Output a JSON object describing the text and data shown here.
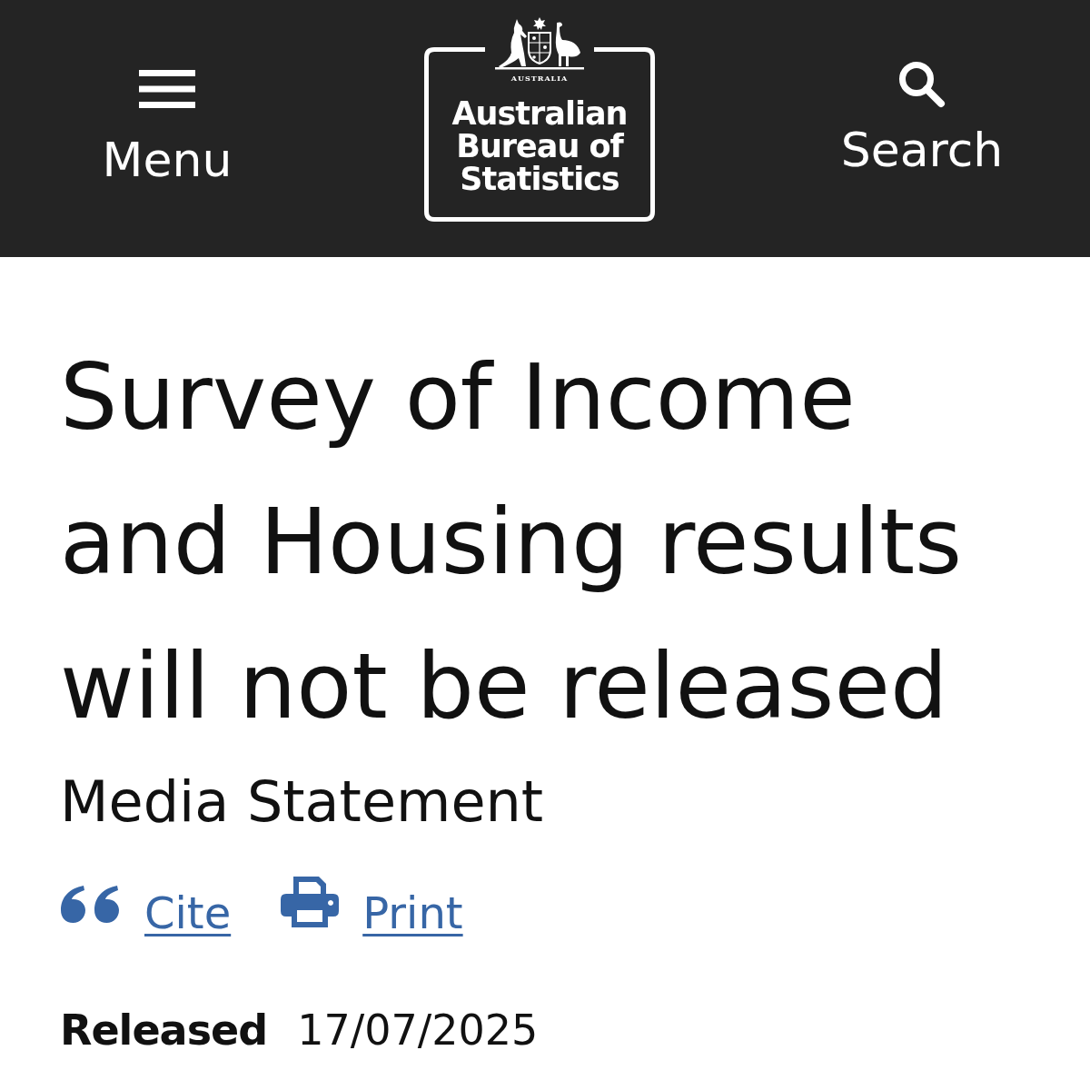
{
  "header": {
    "menu_button": {
      "label": "Menu"
    },
    "logo": {
      "crest_motto": "AUSTRALIA",
      "wordmark": "Australian Bureau of Statistics"
    },
    "search_button": {
      "label": "Search"
    }
  },
  "article": {
    "title": "Survey of Income and Housing results will not be released",
    "content_type": "Media Statement",
    "actions": [
      {
        "kind": "cite",
        "label": "Cite"
      },
      {
        "kind": "print",
        "label": "Print"
      }
    ],
    "released": {
      "label": "Released",
      "date": "17/07/2025"
    }
  }
}
